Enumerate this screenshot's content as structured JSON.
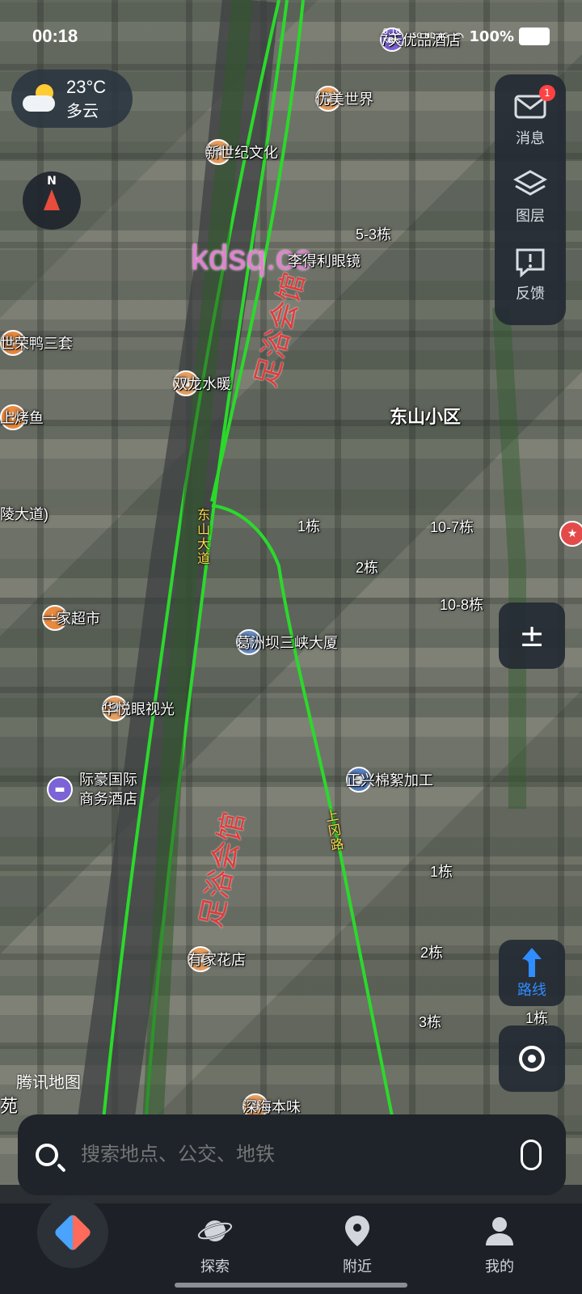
{
  "status_bar": {
    "time": "00:18",
    "net_speed": "0.10 KB/s",
    "network": "5G HD 4G",
    "battery": "100%"
  },
  "weather": {
    "temp": "23°C",
    "condition": "多云",
    "icon": "cloud-sun-icon"
  },
  "compass": {
    "north_label": "N"
  },
  "watermark": "kdsq.cc",
  "right_panel": {
    "messages_label": "消息",
    "messages_badge": "1",
    "layers_label": "图层",
    "feedback_label": "反馈"
  },
  "zoom": {
    "symbol": "±"
  },
  "route_button": {
    "label": "路线"
  },
  "map_brand": "腾讯地图",
  "map_labels": {
    "poi_top": "7天优品酒店",
    "youmei": "优美世界",
    "xinshiji": "新世纪文化",
    "bldg_53": "5-3栋",
    "lideli": "李得利眼镜",
    "ronya": "世荣鸭三套",
    "shuanglong": "双龙水暖",
    "kaoyu": "上烤鱼",
    "dongshan_xiaoqu": "东山小区",
    "lingdadao": "陵大道)",
    "bldg_1": "1栋",
    "bldg_107": "10-7栋",
    "bldg_2": "2栋",
    "bldg_108": "10-8栋",
    "yijia": "一家超市",
    "gezhouba": "葛洲坝三峡大厦",
    "huayue": "华悦眼视光",
    "jihao_1": "际豪国际",
    "jihao_2": "商务酒店",
    "zhengxing": "正兴棉絮加工",
    "b1": "1栋",
    "b2": "2栋",
    "b3": "3栋",
    "b1b": "1栋",
    "youjia": "有家花店",
    "shenhai": "深海本味",
    "yuan": "苑",
    "dongshan_dadao": "东山大道",
    "shanggang": "上冈路",
    "zuyu_1": "足浴会馆",
    "zuyu_2": "足浴会馆"
  },
  "search": {
    "placeholder": "搜索地点、公交、地铁"
  },
  "tabs": [
    {
      "label": "探索",
      "icon": "planet-icon"
    },
    {
      "label": "附近",
      "icon": "pin-icon"
    },
    {
      "label": "我的",
      "icon": "user-icon"
    }
  ],
  "colors": {
    "route_green": "#2bd92b",
    "accent_blue": "#2f8dff",
    "badge_red": "#ff4343"
  }
}
